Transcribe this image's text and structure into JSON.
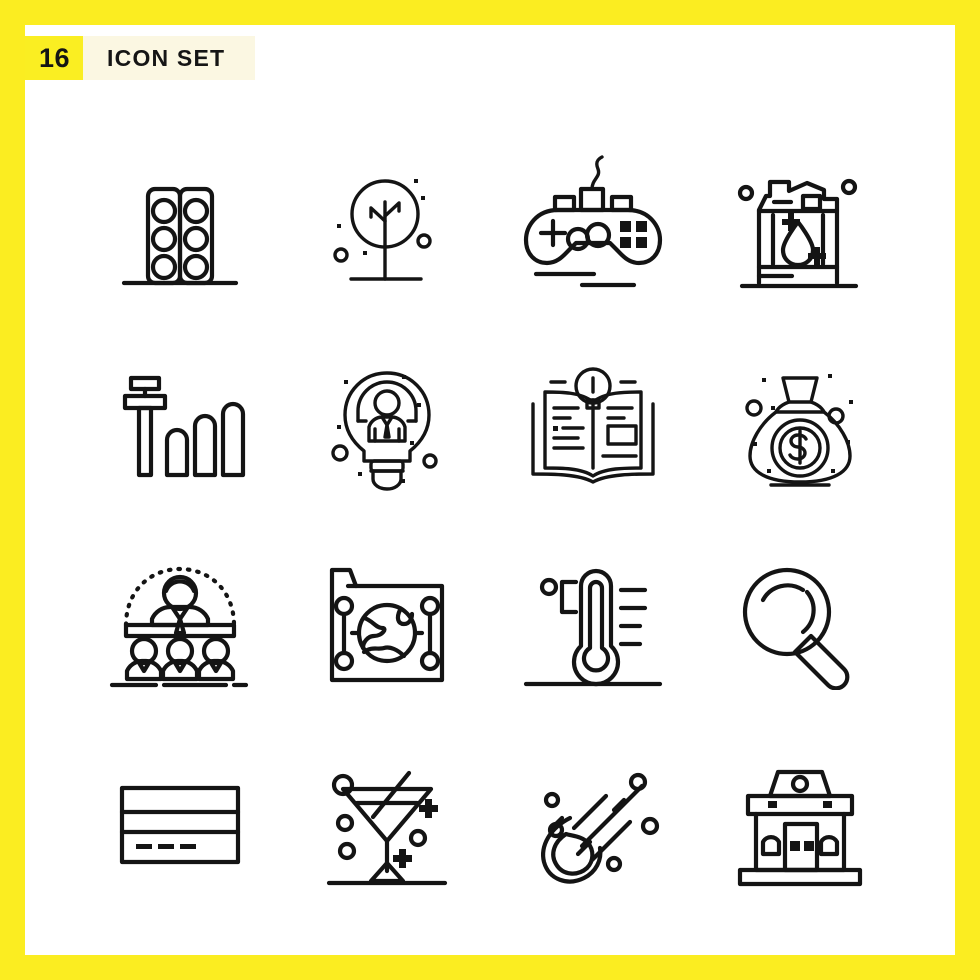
{
  "page": {
    "border_color": "#FBED21",
    "canvas_color": "#FFFFFF",
    "stroke_color": "#141414"
  },
  "header": {
    "count": "16",
    "title": "ICON SET",
    "count_chip_color": "#FAEE22",
    "title_plate_color": "#FBF7E2"
  },
  "grid": {
    "columns": 4,
    "rows": 4,
    "icons": [
      {
        "name": "pills-blister-pack-icon",
        "label": "Pills"
      },
      {
        "name": "tree-icon",
        "label": "Tree"
      },
      {
        "name": "game-controller-icon",
        "label": "Game Controller"
      },
      {
        "name": "detergent-bottle-icon",
        "label": "Detergent"
      },
      {
        "name": "control-tower-growth-icon",
        "label": "Tower Chart"
      },
      {
        "name": "lightbulb-businessman-icon",
        "label": "Creative Idea"
      },
      {
        "name": "open-book-idea-icon",
        "label": "Knowledge"
      },
      {
        "name": "money-bag-icon",
        "label": "Money Bag"
      },
      {
        "name": "conference-speaker-icon",
        "label": "Presentation"
      },
      {
        "name": "folder-globe-icon",
        "label": "Shared Folder"
      },
      {
        "name": "thermometer-celsius-icon",
        "label": "Temperature"
      },
      {
        "name": "magnifying-glass-icon",
        "label": "Search"
      },
      {
        "name": "credit-card-icon",
        "label": "Credit Card"
      },
      {
        "name": "cocktail-glass-icon",
        "label": "Cocktail"
      },
      {
        "name": "comet-icon",
        "label": "Comet"
      },
      {
        "name": "store-building-icon",
        "label": "Store"
      }
    ]
  }
}
